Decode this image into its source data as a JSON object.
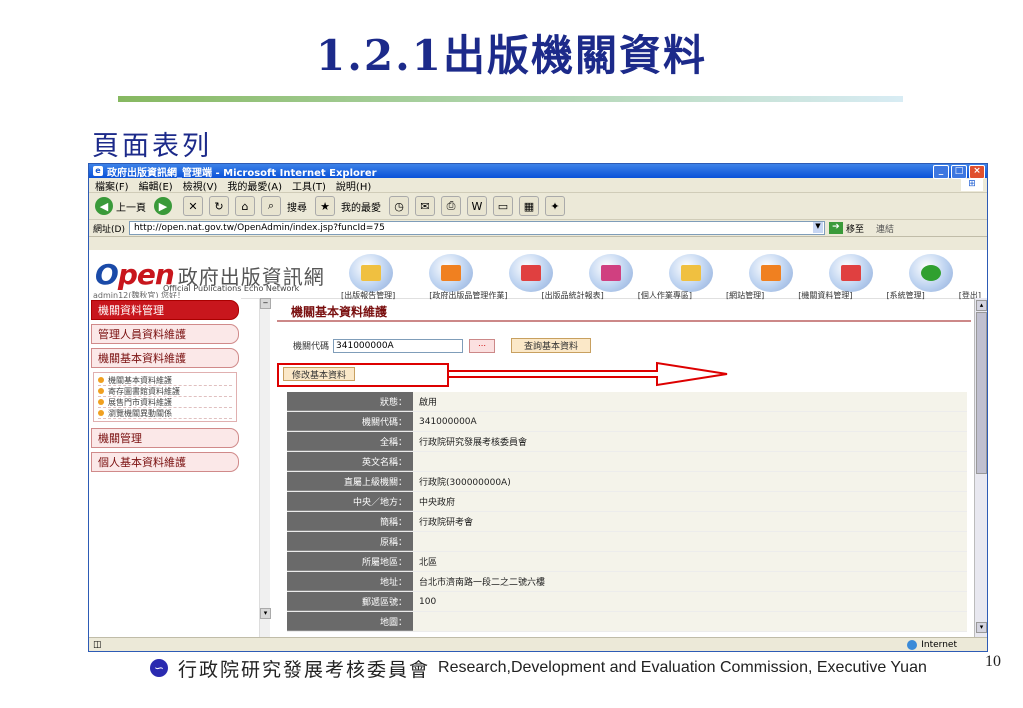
{
  "slide": {
    "title": "1.2.1出版機關資料",
    "subtitle": "頁面表列",
    "footer_cn": "行政院研究發展考核委員會",
    "footer_en": "Research,Development and Evaluation Commission, Executive Yuan",
    "page_number": "10"
  },
  "browser": {
    "window_title": "政府出版資訊網_管理端 - Microsoft Internet Explorer",
    "menu": [
      "檔案(F)",
      "編輯(E)",
      "檢視(V)",
      "我的最愛(A)",
      "工具(T)",
      "說明(H)"
    ],
    "toolbar": {
      "back": "上一頁",
      "search": "搜尋",
      "favorites": "我的最愛"
    },
    "address_label": "網址(D)",
    "url": "http://open.nat.gov.tw/OpenAdmin/index.jsp?funcId=75",
    "go_label": "移至",
    "links_label": "連結",
    "status_zone": "Internet"
  },
  "site": {
    "logo_open": "pen",
    "logo_cn": "政府出版資訊網",
    "logo_en": "Official Publications Echo Network",
    "admin_greeting": "admin12(魏秋宜) 您好！",
    "nav_links": [
      "[出版報告管理]",
      "[政府出版品管理作業]",
      "[出版品統計報表]",
      "[個人作業專區]",
      "[網站管理]",
      "[機關資料管理]",
      "[系統管理]",
      "[登出]"
    ]
  },
  "sidebar": {
    "section_active": "機關資料管理",
    "items": [
      "管理人員資料維護",
      "機關基本資料維護"
    ],
    "sub_items": [
      "機關基本資料維護",
      "寄存圖書館資料維護",
      "展售門市資料維護",
      "瀏覽機關異動關係"
    ],
    "items_after": [
      "機關管理",
      "個人基本資料維護"
    ]
  },
  "main": {
    "title": "機關基本資料維護",
    "query_label": "機關代碼",
    "query_value": "341000000A",
    "query_button": "查詢基本資料",
    "edit_button": "修改基本資料",
    "rows": [
      {
        "label": "狀態：",
        "value": "啟用"
      },
      {
        "label": "機關代碼：",
        "value": "341000000A"
      },
      {
        "label": "全稱：",
        "value": "行政院研究發展考核委員會"
      },
      {
        "label": "英文名稱：",
        "value": ""
      },
      {
        "label": "直屬上級機關：",
        "value": "行政院(300000000A)"
      },
      {
        "label": "中央／地方：",
        "value": "中央政府"
      },
      {
        "label": "簡稱：",
        "value": "行政院研考會"
      },
      {
        "label": "原稱：",
        "value": ""
      },
      {
        "label": "所屬地區：",
        "value": "北區"
      },
      {
        "label": "地址：",
        "value": "台北市濟南路一段二之二號六樓"
      },
      {
        "label": "郵遞區號：",
        "value": "100"
      },
      {
        "label": "地圖：",
        "value": ""
      }
    ]
  },
  "colors": {
    "title_blue": "#1c2a8a",
    "brand_red": "#c8161d",
    "label_gray": "#6a6a6a"
  }
}
